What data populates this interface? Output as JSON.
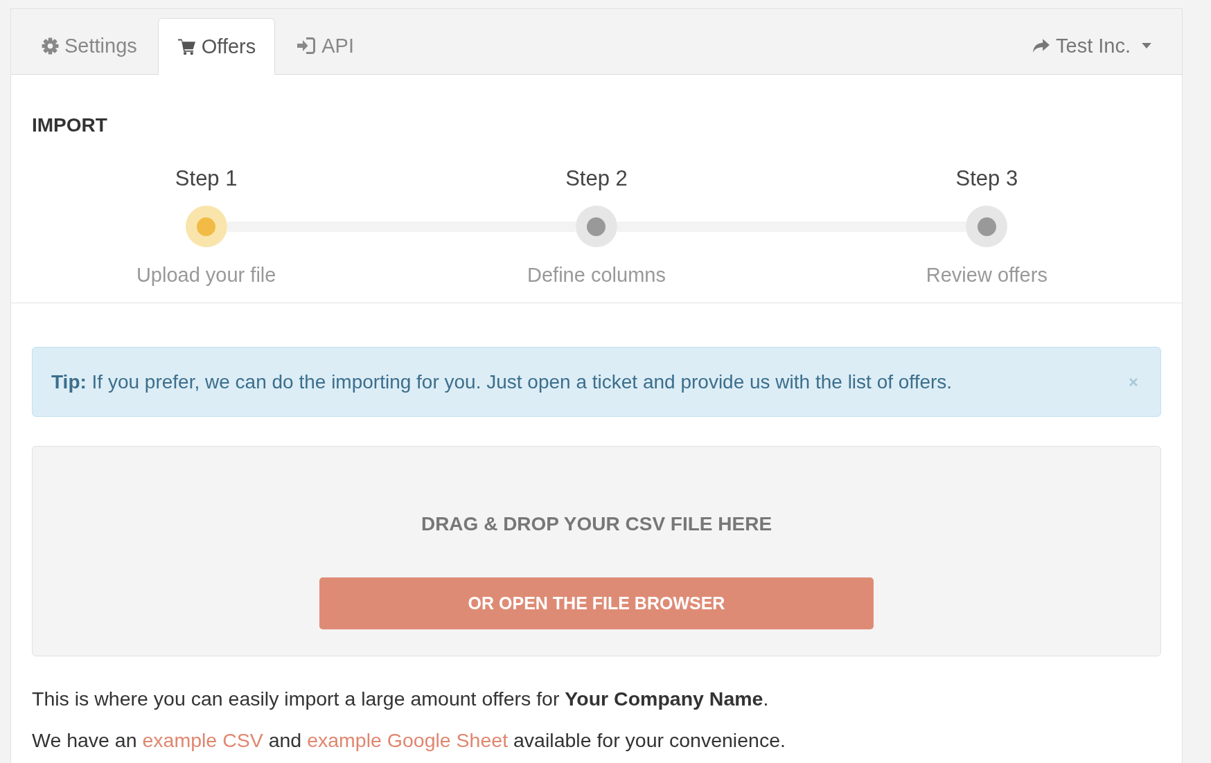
{
  "tabs": [
    {
      "label": "Settings",
      "selected": false
    },
    {
      "label": "Offers",
      "selected": true
    },
    {
      "label": "API",
      "selected": false
    }
  ],
  "account_menu": {
    "label": "Test Inc."
  },
  "section_title": "IMPORT",
  "steps": [
    {
      "title": "Step 1",
      "caption": "Upload your file",
      "selected": true
    },
    {
      "title": "Step 2",
      "caption": "Define columns",
      "selected": false
    },
    {
      "title": "Step 3",
      "caption": "Review offers",
      "selected": false
    }
  ],
  "tip": {
    "text": "**Tip:** If you prefer, we can do the importing for you. Just open a ticket and provide us with the list of offers."
  },
  "dropzone": {
    "prompt": "DRAG & DROP YOUR CSV FILE HERE",
    "button": "OR OPEN THE FILE BROWSER"
  },
  "intro": "This is where you can easily import a large amount offers for **Your Company Name**.",
  "examples_note": [
    {
      "kind": "text",
      "text": "We have an "
    },
    {
      "kind": "link",
      "text": "example CSV"
    },
    {
      "kind": "text",
      "text": " and "
    },
    {
      "kind": "link",
      "text": "example Google Sheet"
    },
    {
      "kind": "text",
      "text": " available for your convenience."
    }
  ]
}
